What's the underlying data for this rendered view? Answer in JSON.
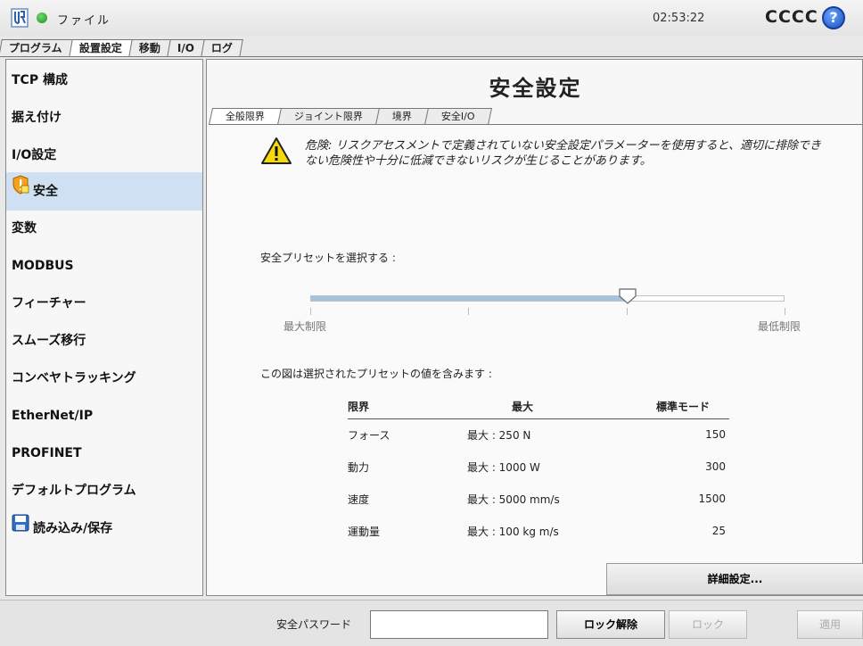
{
  "topbar": {
    "file_menu": "ファイル",
    "clock": "02:53:22",
    "robot_name": "CCCC",
    "help_glyph": "?"
  },
  "main_tabs": [
    "プログラム",
    "設置設定",
    "移動",
    "I/O",
    "ログ"
  ],
  "sidebar": {
    "items": [
      {
        "label": "TCP 構成"
      },
      {
        "label": "据え付け"
      },
      {
        "label": "I/O設定"
      },
      {
        "label": "安全",
        "icon": "safety-shield-icon"
      },
      {
        "label": "変数"
      },
      {
        "label": "MODBUS"
      },
      {
        "label": "フィーチャー"
      },
      {
        "label": "スムーズ移行"
      },
      {
        "label": "コンベヤトラッキング"
      },
      {
        "label": "EtherNet/IP"
      },
      {
        "label": "PROFINET"
      },
      {
        "label": "デフォルトプログラム"
      },
      {
        "label": "読み込み/保存",
        "icon": "floppy-disk-icon"
      }
    ]
  },
  "content": {
    "title": "安全設定",
    "sub_tabs": [
      "全般限界",
      "ジョイント限界",
      "境界",
      "安全I/O"
    ],
    "warning": "危険: リスクアセスメントで定義されていない安全設定パラメーターを使用すると、適切に排除できない危険性や十分に低減できないリスクが生じることがあります。",
    "preset_label": "安全プリセットを選択する :",
    "slider": {
      "min_label": "最大制限",
      "max_label": "最低制限",
      "value_fraction": 0.67
    },
    "table_caption": "この図は選択されたプリセットの値を含みます :",
    "table": {
      "headers": [
        "限界",
        "最大",
        "標準モード"
      ],
      "rows": [
        [
          "フォース",
          "最大 : 250 N",
          "150"
        ],
        [
          "動力",
          "最大 : 1000 W",
          "300"
        ],
        [
          "速度",
          "最大 : 5000 mm/s",
          "1500"
        ],
        [
          "運動量",
          "最大 : 100 kg m/s",
          "25"
        ]
      ]
    },
    "advanced_button": "詳細設定..."
  },
  "footer": {
    "password_label": "安全パスワード",
    "password_value": "",
    "unlock": "ロック解除",
    "lock": "ロック",
    "apply": "適用"
  },
  "colors": {
    "selection": "#cfe0f2",
    "slider_fill": "#a6c3dd",
    "warning_yellow": "#f5d90a",
    "help_blue": "#1a4fc0"
  }
}
